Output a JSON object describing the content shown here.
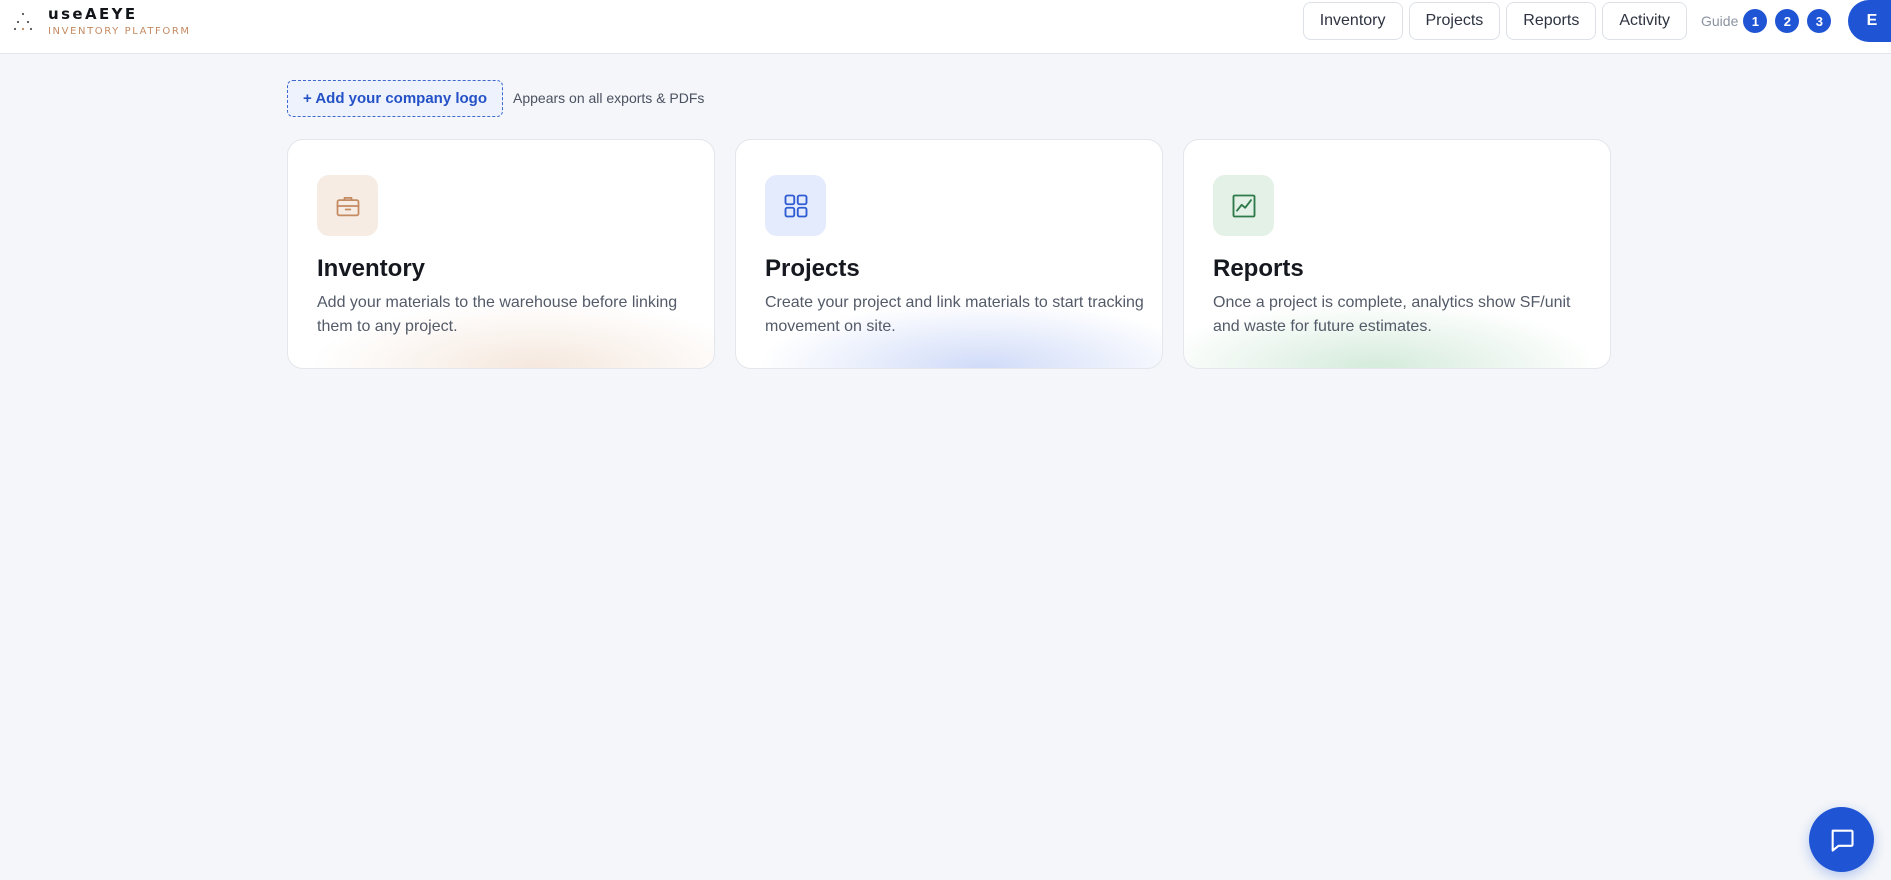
{
  "brand": {
    "name": "useAEYE",
    "subtitle": "INVENTORY PLATFORM"
  },
  "nav": {
    "items": [
      {
        "label": "Inventory"
      },
      {
        "label": "Projects"
      },
      {
        "label": "Reports"
      },
      {
        "label": "Activity"
      }
    ]
  },
  "guide": {
    "label": "Guide",
    "steps": [
      "1",
      "2",
      "3"
    ]
  },
  "user": {
    "initial": "E"
  },
  "logo": {
    "button_label": "+ Add your company logo",
    "note": "Appears on all exports & PDFs"
  },
  "cards": [
    {
      "title": "Inventory",
      "description": "Add your materials to the warehouse before linking them to any project.",
      "icon": "toolbox-icon",
      "accent": "#c48a62"
    },
    {
      "title": "Projects",
      "description": "Create your project and link materials to start tracking movement on site.",
      "icon": "grid-icon",
      "accent": "#2f5bd3"
    },
    {
      "title": "Reports",
      "description": "Once a project is complete, analytics show SF/unit and waste for future estimates.",
      "icon": "line-chart-icon",
      "accent": "#2f7a4a"
    }
  ],
  "colors": {
    "primary": "#1f55d4",
    "background": "#f4f6f9",
    "brand_sub": "#c48a62"
  },
  "chat": {
    "icon": "chat-bubble-icon"
  }
}
